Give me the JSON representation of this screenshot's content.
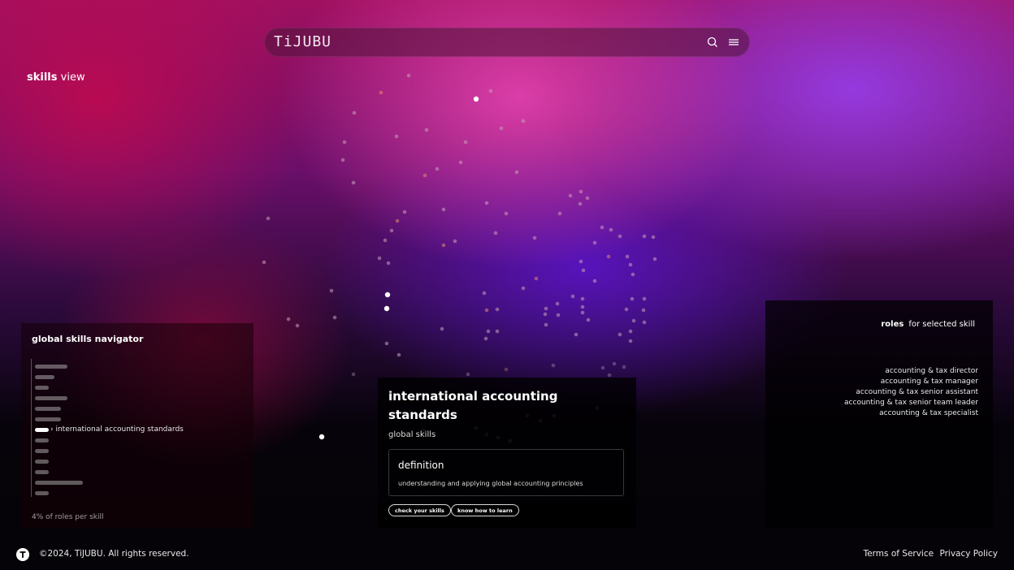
{
  "header": {
    "logo_text": "TiJUBU",
    "search_icon": "search-icon",
    "menu_icon": "hamburger-menu-icon"
  },
  "view_label": {
    "bold": "skills",
    "rest": "view"
  },
  "navigator": {
    "title": "global skills navigator",
    "selected_label": "› international accounting standards",
    "footer": "4% of roles per skill",
    "bars": [
      {
        "width": 0.55,
        "selected": false
      },
      {
        "width": 0.34,
        "selected": false
      },
      {
        "width": 0.23,
        "selected": false
      },
      {
        "width": 0.55,
        "selected": false
      },
      {
        "width": 0.45,
        "selected": false
      },
      {
        "width": 0.45,
        "selected": false
      },
      {
        "width": 0.23,
        "selected": true
      },
      {
        "width": 0.23,
        "selected": false
      },
      {
        "width": 0.23,
        "selected": false
      },
      {
        "width": 0.23,
        "selected": false
      },
      {
        "width": 0.23,
        "selected": false
      },
      {
        "width": 0.82,
        "selected": false
      },
      {
        "width": 0.23,
        "selected": false
      }
    ]
  },
  "skill": {
    "title": "international accounting standards",
    "category": "global skills",
    "definition_heading": "definition",
    "definition_text": "understanding and applying global accounting principles",
    "check_button": "check your skills",
    "learn_button": "know how to learn"
  },
  "roles": {
    "header_bold": "roles",
    "header_rest": "for selected skill",
    "items": [
      "accounting & tax director",
      "accounting & tax manager",
      "accounting & tax senior assistant",
      "accounting & tax senior team leader",
      "accounting & tax specialist"
    ]
  },
  "footer": {
    "copyright": "©2024, TiJUBU. All rights reserved.",
    "terms": "Terms of Service",
    "privacy": "Privacy Policy"
  },
  "colors": {
    "dot": "#c8a0b8",
    "dot_highlight": "#ffffff",
    "dot_warm": "#e08a70"
  }
}
